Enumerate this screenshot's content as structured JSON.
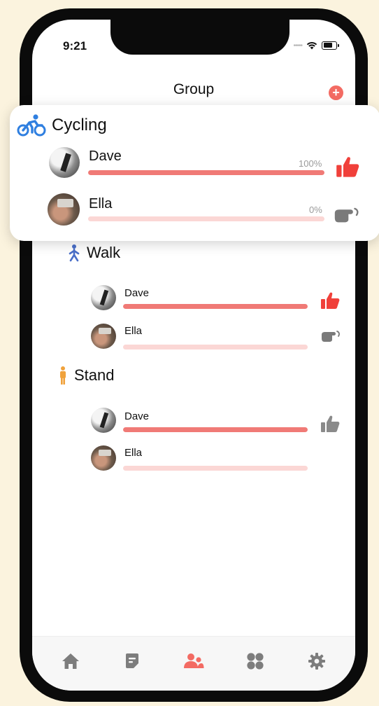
{
  "status": {
    "time": "9:21"
  },
  "header": {
    "title": "Group",
    "add_icon": "plus-circle-icon",
    "accent": "#f36b63"
  },
  "sections": [
    {
      "name": "Cycling",
      "icon": "cycling-icon",
      "icon_color": "#2f7fe0",
      "members": [
        {
          "name": "Dave",
          "progress": 1.0,
          "percent_label": "100%",
          "status_icon": "thumbs-up-icon",
          "status_color": "#f0403a"
        },
        {
          "name": "Ella",
          "progress": 0.0,
          "percent_label": "0%",
          "status_icon": "pointing-hand-icon",
          "status_color": "#7a7a7a"
        }
      ]
    },
    {
      "name": "Walk",
      "icon": "walking-icon",
      "icon_color": "#4a6fc9",
      "members": [
        {
          "name": "Dave",
          "progress": 1.0,
          "status_icon": "thumbs-up-icon",
          "status_color": "#f0403a"
        },
        {
          "name": "Ella",
          "progress": 0.0,
          "status_icon": "pointing-hand-icon",
          "status_color": "#7a7a7a"
        }
      ]
    },
    {
      "name": "Stand",
      "icon": "standing-person-icon",
      "icon_color": "#f0a23c",
      "members": [
        {
          "name": "Dave",
          "progress": 1.0,
          "status_icon": "thumbs-up-icon",
          "status_color": "#8a8a8a"
        },
        {
          "name": "Ella",
          "progress": 0.0
        }
      ]
    }
  ],
  "tabbar": {
    "tabs": [
      {
        "icon": "home-icon",
        "active": false
      },
      {
        "icon": "notes-icon",
        "active": false
      },
      {
        "icon": "group-icon",
        "active": true
      },
      {
        "icon": "grid-icon",
        "active": false
      },
      {
        "icon": "settings-gear-icon",
        "active": false
      }
    ],
    "active_color": "#f36b63",
    "inactive_color": "#7d7d7d"
  }
}
